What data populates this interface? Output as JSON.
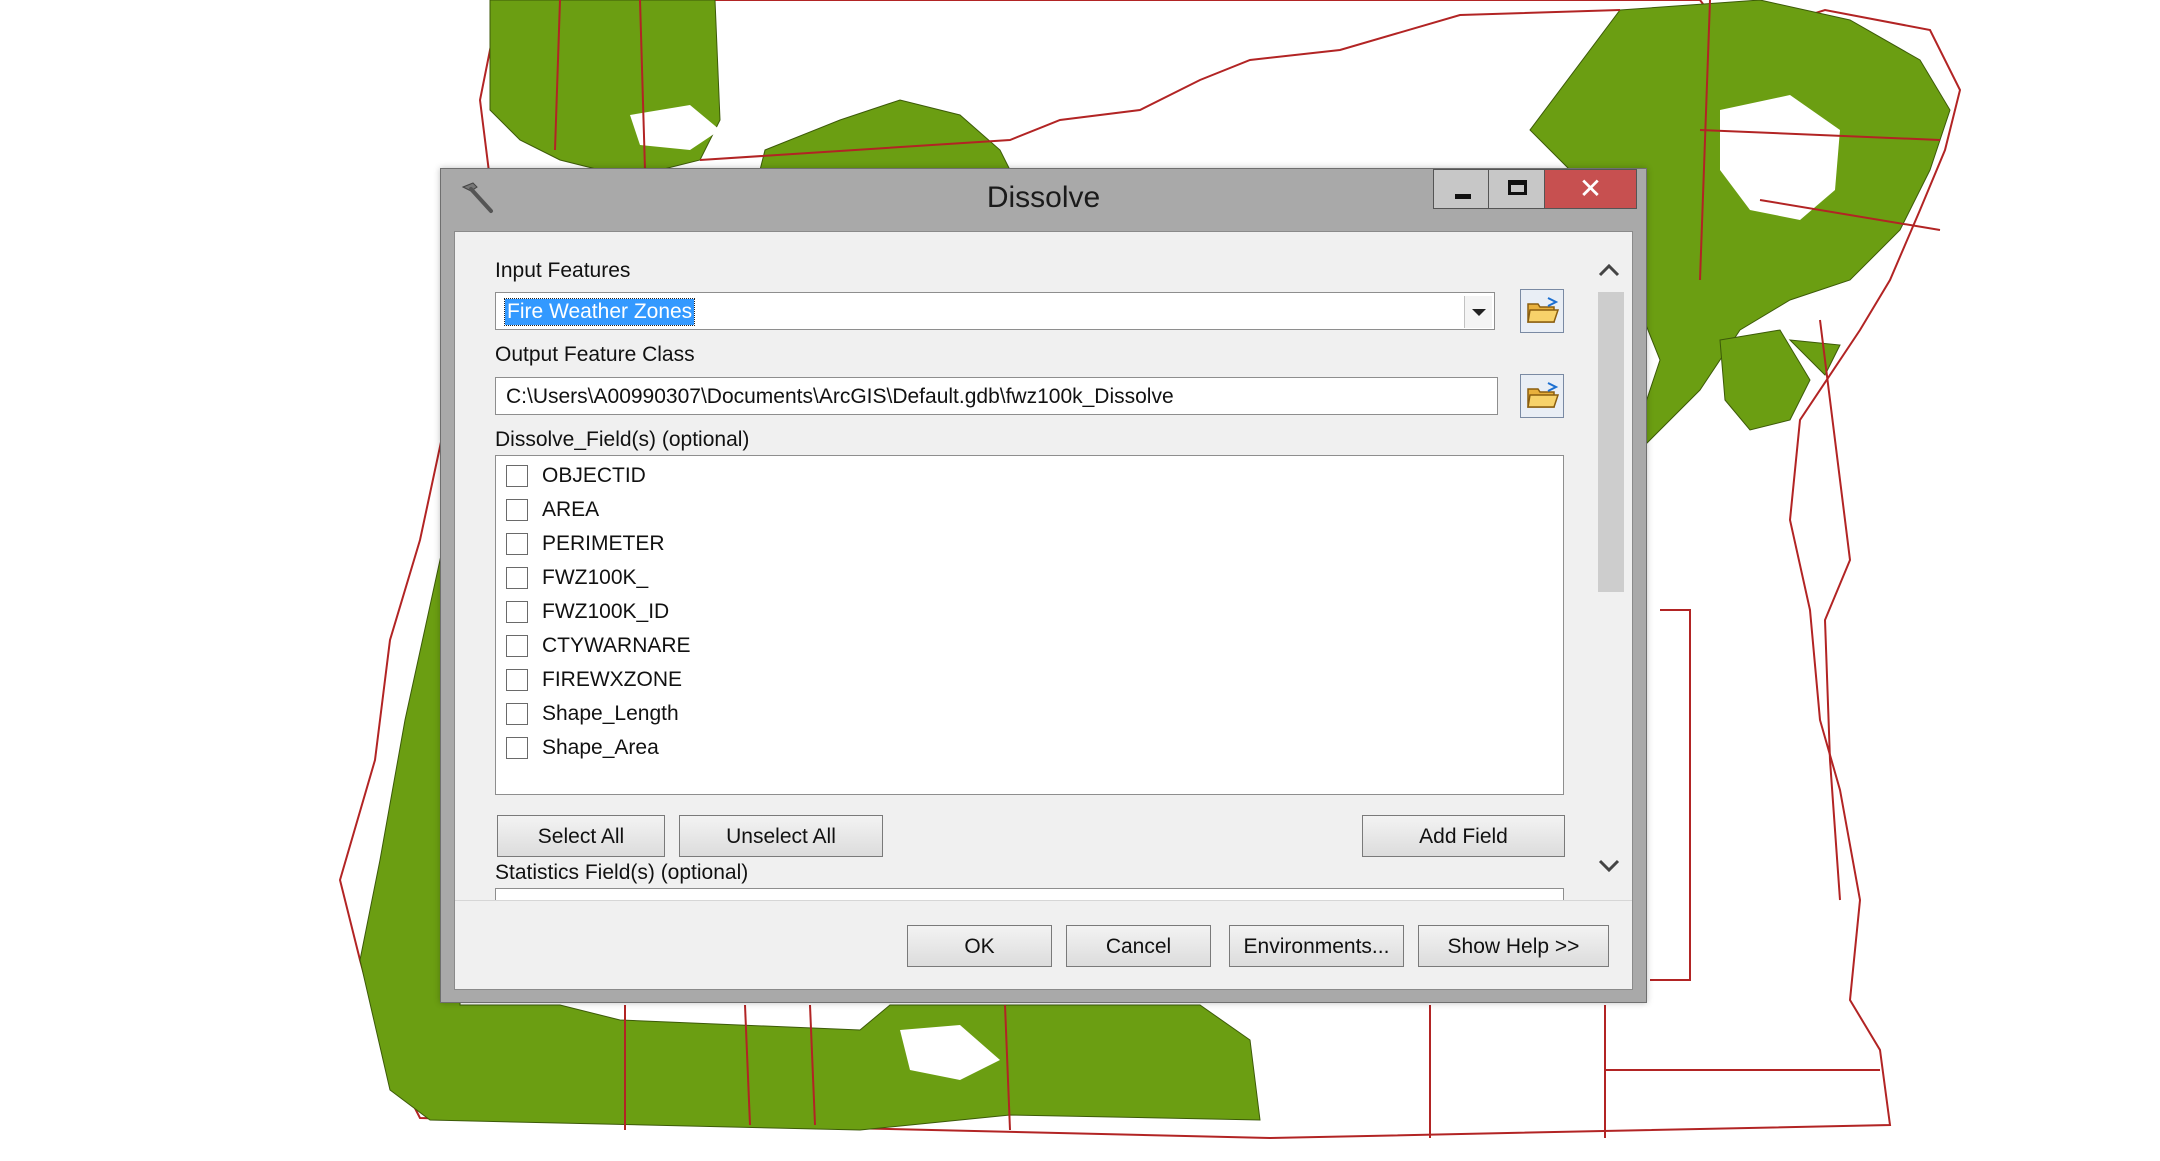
{
  "background": {
    "type": "map",
    "land_color": "#6b9e12",
    "boundary_color": "#b22424",
    "outline_color": "#b22424"
  },
  "dialog": {
    "title": "Dissolve",
    "title_icon": "hammer-icon",
    "window_buttons": {
      "minimize_icon": "minimize-icon",
      "maximize_icon": "maximize-icon",
      "close_icon": "close-icon",
      "close_glyph": "✕",
      "close_color": "#c75050"
    },
    "input_features": {
      "label": "Input Features",
      "value": "Fire Weather Zones",
      "browse_icon": "open-folder-icon"
    },
    "output_feature_class": {
      "label": "Output Feature Class",
      "value": "C:\\Users\\A00990307\\Documents\\ArcGIS\\Default.gdb\\fwz100k_Dissolve",
      "browse_icon": "open-folder-icon"
    },
    "dissolve_fields": {
      "label": "Dissolve_Field(s) (optional)",
      "fields": [
        {
          "name": "OBJECTID",
          "checked": false
        },
        {
          "name": "AREA",
          "checked": false
        },
        {
          "name": "PERIMETER",
          "checked": false
        },
        {
          "name": "FWZ100K_",
          "checked": false
        },
        {
          "name": "FWZ100K_ID",
          "checked": false
        },
        {
          "name": "CTYWARNARE",
          "checked": false
        },
        {
          "name": "FIREWXZONE",
          "checked": false
        },
        {
          "name": "Shape_Length",
          "checked": false
        },
        {
          "name": "Shape_Area",
          "checked": false
        }
      ]
    },
    "field_buttons": {
      "select_all": "Select All",
      "unselect_all": "Unselect All",
      "add_field": "Add Field"
    },
    "statistics_fields": {
      "label": "Statistics Field(s) (optional)"
    },
    "footer": {
      "ok": "OK",
      "cancel": "Cancel",
      "environments": "Environments...",
      "show_help": "Show Help >>"
    }
  }
}
